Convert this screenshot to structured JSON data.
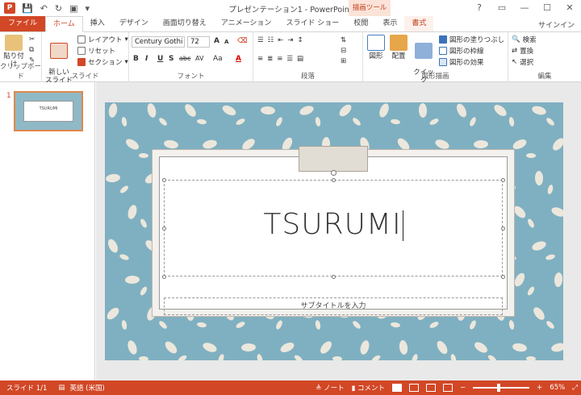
{
  "window": {
    "title": "プレゼンテーション1 - PowerPoint",
    "context_header": "描画ツール",
    "signin": "サインイン",
    "controls": [
      "?",
      "▭",
      "—",
      "☐",
      "✕"
    ]
  },
  "tabs": [
    {
      "label": "ファイル",
      "kind": "file"
    },
    {
      "label": "ホーム",
      "kind": "active"
    },
    {
      "label": "挿入",
      "kind": "normal"
    },
    {
      "label": "デザイン",
      "kind": "normal"
    },
    {
      "label": "画面切り替え",
      "kind": "normal"
    },
    {
      "label": "アニメーション",
      "kind": "normal"
    },
    {
      "label": "スライド ショー",
      "kind": "normal"
    },
    {
      "label": "校閲",
      "kind": "normal"
    },
    {
      "label": "表示",
      "kind": "normal"
    },
    {
      "label": "書式",
      "kind": "context"
    }
  ],
  "ribbon": {
    "clipboard": {
      "label": "クリップボード",
      "paste": "貼り付け"
    },
    "slides": {
      "label": "スライド",
      "new_slide": "新しい\nスライド",
      "layout": "レイアウト",
      "reset": "リセット",
      "section": "セクション"
    },
    "font": {
      "label": "フォント",
      "family": "Century Gothi",
      "size": "72",
      "grow": "A",
      "shrink": "A",
      "buttons": [
        "B",
        "I",
        "U",
        "S",
        "abc",
        "AV",
        "Aa",
        "A"
      ]
    },
    "paragraph": {
      "label": "段落"
    },
    "drawing": {
      "label": "図形描画",
      "shapes": "図形",
      "arrange": "配置",
      "quick_styles": "クイック\nスタイル",
      "fill": "図形の塗りつぶし",
      "outline": "図形の枠線",
      "effects": "図形の効果"
    },
    "editing": {
      "label": "編集",
      "find": "検索",
      "replace": "置換",
      "select": "選択"
    }
  },
  "thumbnails": [
    {
      "number": "1",
      "text": "TSURUMI"
    }
  ],
  "slide": {
    "title": "TSURUMI",
    "subtitle_placeholder": "サブタイトルを入力",
    "background_color": "#7fb0c1",
    "pattern_color": "#ece7dc"
  },
  "status": {
    "slide": "スライド 1/1",
    "language": "英語 (米国)",
    "notes": "ノート",
    "comments": "コメント",
    "zoom": "65%",
    "accent": "#d24726"
  }
}
